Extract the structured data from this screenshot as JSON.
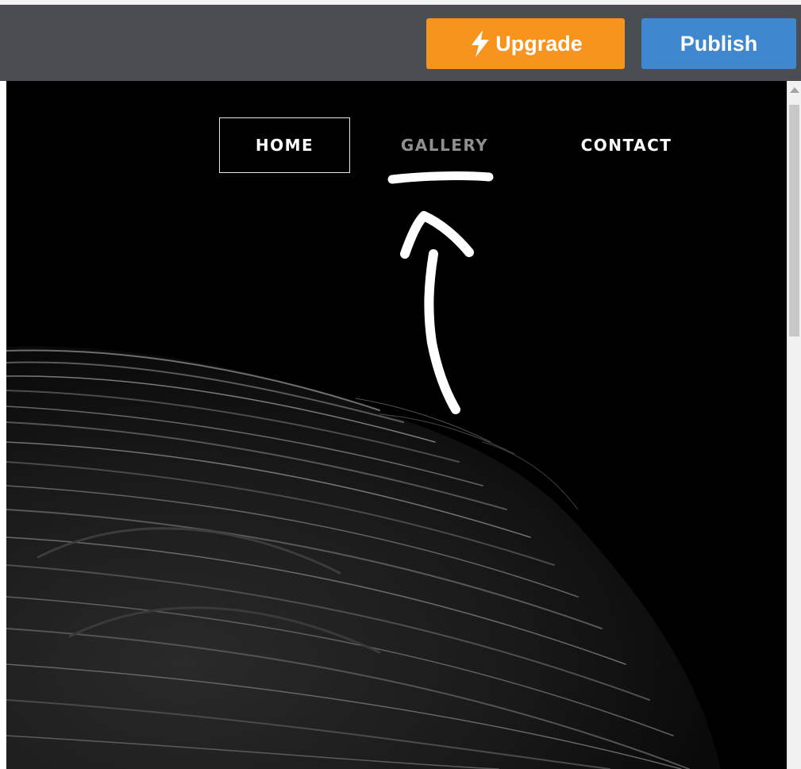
{
  "toolbar": {
    "upgrade_label": "Upgrade",
    "upgrade_icon": "lightning-bolt-icon",
    "publish_label": "Publish",
    "colors": {
      "toolbar_bg": "#4a4d51",
      "upgrade_bg": "#f7941e",
      "publish_bg": "#3f87cf"
    }
  },
  "site_nav": {
    "items": [
      {
        "label": "HOME",
        "state": "selected-outlined"
      },
      {
        "label": "GALLERY",
        "state": "dimmed"
      },
      {
        "label": "CONTACT",
        "state": "normal"
      }
    ]
  },
  "canvas": {
    "background": "#000000",
    "image": "black-and-white-hair-photo"
  },
  "annotation": {
    "type": "hand-drawn-arrow-and-underline",
    "color": "#ffffff",
    "points_to": "GALLERY"
  }
}
